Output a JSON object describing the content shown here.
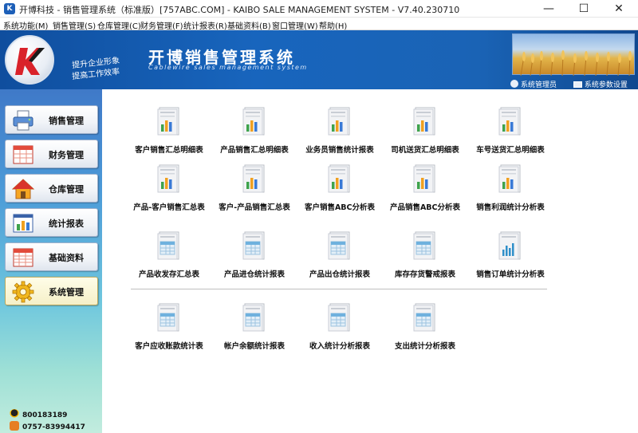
{
  "window": {
    "title": "开博科技 - 销售管理系统（标准版）[757ABC.COM] - KAIBO SALE MANAGEMENT SYSTEM - V7.40.230710",
    "minimize": "—",
    "maximize": "☐",
    "close": "✕"
  },
  "menu": [
    "系统功能(M)",
    "销售管理(S)",
    "仓库管理(C)",
    "财务管理(F)",
    "统计报表(R)",
    "基础资料(B)",
    "窗口管理(W)",
    "帮助(H)"
  ],
  "banner": {
    "slogan1": "提升企业形象",
    "slogan2": "提高工作效率",
    "app_title": "开博销售管理系统",
    "app_subtitle": "Cablewire sales management system",
    "user": "系统管理员",
    "settings": "系统参数设置"
  },
  "sidebar": [
    {
      "label": "销售管理",
      "icon": "printer-icon"
    },
    {
      "label": "财务管理",
      "icon": "grid-ledger-icon"
    },
    {
      "label": "仓库管理",
      "icon": "house-icon"
    },
    {
      "label": "统计报表",
      "icon": "bar-chart-icon"
    },
    {
      "label": "基础资料",
      "icon": "table-icon"
    },
    {
      "label": "系统管理",
      "icon": "gear-icon"
    }
  ],
  "contacts": {
    "qq": "800183189",
    "phone": "0757-83994417"
  },
  "reports": [
    {
      "label": "客户销售汇总明细表",
      "icon": "bar-report-icon"
    },
    {
      "label": "产品销售汇总明细表",
      "icon": "bar-report-icon"
    },
    {
      "label": "业务员销售统计报表",
      "icon": "bar-report-icon"
    },
    {
      "label": "司机送货汇总明细表",
      "icon": "bar-report-icon"
    },
    {
      "label": "车号送货汇总明细表",
      "icon": "bar-report-icon"
    },
    {
      "label": "产品-客户销售汇总表",
      "icon": "bar-report-icon"
    },
    {
      "label": "客户-产品销售汇总表",
      "icon": "bar-report-icon"
    },
    {
      "label": "客户销售ABC分析表",
      "icon": "bar-report-icon"
    },
    {
      "label": "产品销售ABC分析表",
      "icon": "bar-report-icon"
    },
    {
      "label": "销售利润统计分析表",
      "icon": "bar-report-icon"
    },
    {
      "label": "产品收发存汇总表",
      "icon": "table-report-icon"
    },
    {
      "label": "产品进仓统计报表",
      "icon": "table-report-icon"
    },
    {
      "label": "产品出仓统计报表",
      "icon": "table-report-icon"
    },
    {
      "label": "库存存货警戒报表",
      "icon": "table-report-icon"
    },
    {
      "label": "销售订单统计分析表",
      "icon": "column-report-icon"
    },
    {
      "label": "客户应收账款统计表",
      "icon": "table-report-icon"
    },
    {
      "label": "帐户余额统计报表",
      "icon": "table-report-icon"
    },
    {
      "label": "收入统计分析报表",
      "icon": "table-report-icon"
    },
    {
      "label": "支出统计分析报表",
      "icon": "table-report-icon"
    }
  ],
  "colors": {
    "banner": "#1865bd",
    "sidebar_top": "#3f79c8",
    "sidebar_bottom": "#c2ecde"
  }
}
